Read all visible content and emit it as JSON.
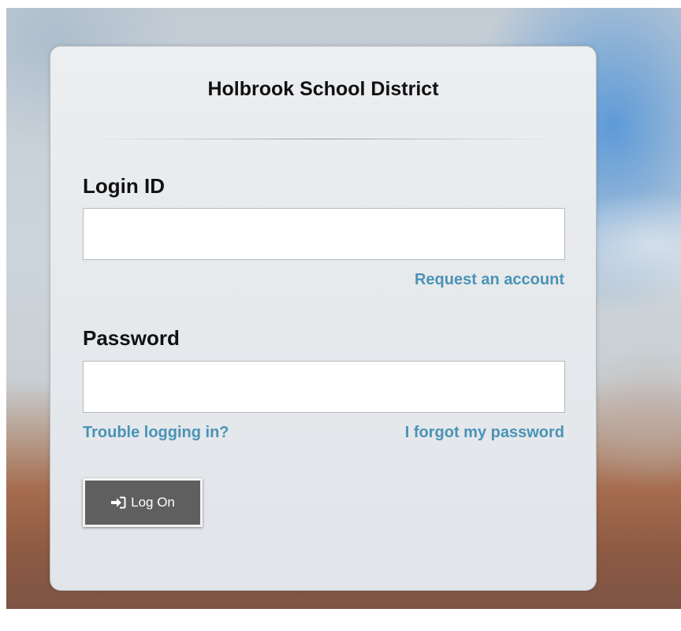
{
  "organization": {
    "name": "Holbrook School District"
  },
  "login_form": {
    "login_id_label": "Login ID",
    "login_id_value": "",
    "login_id_placeholder": "",
    "request_account_link": "Request an account",
    "password_label": "Password",
    "password_value": "",
    "password_placeholder": "",
    "trouble_link": "Trouble logging in?",
    "forgot_link": "I forgot my password",
    "logon_button": {
      "label": "Log On",
      "icon": "sign-in-icon"
    }
  },
  "colors": {
    "link": "#4a93b6",
    "button_bg": "#5f5f5f",
    "card_bg": "#e6e9ec"
  }
}
